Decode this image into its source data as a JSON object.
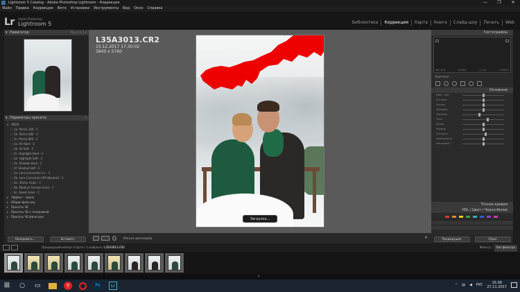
{
  "window": {
    "title": "Lightroom 5 Catalog - Adobe Photoshop Lightroom - Коррекция",
    "controls": [
      "—",
      "❐",
      "✕"
    ]
  },
  "menu": [
    "Файл",
    "Правка",
    "Коррекция",
    "Фото",
    "Установки",
    "Инструменты",
    "Вид",
    "Окно",
    "Справка"
  ],
  "identity": {
    "logo": "Lr",
    "small_caption": "Adobe Photoshop",
    "app_name": "Lightroom 5"
  },
  "modules": [
    {
      "label": "Библиотека",
      "active": false
    },
    {
      "label": "Коррекция",
      "active": true
    },
    {
      "label": "Карта",
      "active": false
    },
    {
      "label": "Книга",
      "active": false
    },
    {
      "label": "Слайд-шоу",
      "active": false
    },
    {
      "label": "Печать",
      "active": false
    },
    {
      "label": "Web",
      "active": false
    }
  ],
  "left_panel": {
    "navigator_title": "Навигатор",
    "navigator_options": "FILL  1:1  3:1",
    "presets_title": "Параметры пресета",
    "presets": [
      {
        "label": "VSCO",
        "kind": "folder open"
      },
      {
        "label": "1a. Portra 160 - C",
        "kind": "leaf"
      },
      {
        "label": "1b. Portra 400 - C",
        "kind": "leaf"
      },
      {
        "label": "1c. Portra 800 - C",
        "kind": "leaf"
      },
      {
        "label": "2a. All Hard - C",
        "kind": "leaf"
      },
      {
        "label": "2b. All Soft - C",
        "kind": "leaf"
      },
      {
        "label": "2c. Highlight Hard - C",
        "kind": "leaf"
      },
      {
        "label": "2d. Highlight Soft - C",
        "kind": "leaf"
      },
      {
        "label": "2e. Shadow Hard - C",
        "kind": "leaf"
      },
      {
        "label": "2f. Shadow Soft - C",
        "kind": "leaf"
      },
      {
        "label": "3a. Lens Correction 0+ - C",
        "kind": "leaf"
      },
      {
        "label": "3b. Lens Correction Off (Neutral) - C",
        "kind": "leaf"
      },
      {
        "label": "4a. 35mm Grain - C",
        "kind": "leaf"
      },
      {
        "label": "4b. Medium Format Grain - C",
        "kind": "leaf"
      },
      {
        "label": "4c. Reset Grain - C",
        "kind": "leaf"
      },
      {
        "label": "Эффект - зерно",
        "kind": "folder"
      },
      {
        "label": "Общие фильтры",
        "kind": "folder"
      },
      {
        "label": "Пресеты ЧБ",
        "kind": "folder"
      },
      {
        "label": "Пресеты ЧБ с тонировкой",
        "kind": "folder"
      },
      {
        "label": "Пресеты ЧБ фильтров",
        "kind": "folder"
      }
    ],
    "copy_button": "Копировать...",
    "paste_button": "Вставить"
  },
  "photo_info": {
    "filename": "L35A3013.CR2",
    "datetime": "15.12.2017 17:30:02",
    "dimensions": "3840 x 5760"
  },
  "loading_label": "Загрузка...",
  "toolbar": {
    "soft_proof_label": "Мягкая цветопроба"
  },
  "right_panel": {
    "histogram_title": "Гистограмма",
    "histogram_values": [
      "ISO 100",
      "50 мм",
      "f / 1,4",
      "1/320 с"
    ],
    "original_label": "Оригинал",
    "basic_title": "Основные",
    "sliders": [
      {
        "label": "Цвет. тем.",
        "level": 0.5
      },
      {
        "label": "Оттенок",
        "level": 0.5
      },
      {
        "label": "Экспоз.",
        "level": 0.5
      },
      {
        "label": "Контраст",
        "level": 0.5
      },
      {
        "label": "Светлые",
        "level": 0.4
      },
      {
        "label": "Тени",
        "level": 0.6
      },
      {
        "label": "Белые",
        "level": 0.5
      },
      {
        "label": "Черные",
        "level": 0.5
      },
      {
        "label": "Четкость",
        "level": 0.55
      },
      {
        "label": "Красочность",
        "level": 0.5
      },
      {
        "label": "Насыщенн.",
        "level": 0.5
      }
    ],
    "tone_curve_title": "Точная кривая",
    "hsl_title": "HSL / Цвет / Черно-белое",
    "hsl_colors": [
      "#d23a3a",
      "#e08a2a",
      "#e0d02a",
      "#3aa04a",
      "#2ab0c0",
      "#3a5ad0",
      "#9a3ad0",
      "#d03aa0"
    ],
    "prev_button": "Предыдущие",
    "reset_button": "Сброс"
  },
  "filmstrip_bar": {
    "crumb": "Предыдущий импорт",
    "count": "8 фото / 1 выбрано /",
    "file": "L35A3013.CR2",
    "filter_label": "Фильтр :",
    "filter_value": "Без фильтра"
  },
  "filmstrip": [
    {
      "selected": true,
      "tone": "cool"
    },
    {
      "selected": false,
      "tone": "warm"
    },
    {
      "selected": false,
      "tone": "warm"
    },
    {
      "selected": false,
      "tone": "cool"
    },
    {
      "selected": false,
      "tone": "cool"
    },
    {
      "selected": false,
      "tone": "warm"
    },
    {
      "selected": false,
      "tone": "dark"
    },
    {
      "selected": false,
      "tone": "dark"
    },
    {
      "selected": false,
      "tone": "cool"
    }
  ],
  "taskbar": {
    "lang": "РУС",
    "time": "15:38",
    "date": "27.11.2017",
    "icons": [
      "windows-start-icon",
      "search-icon",
      "task-view-icon",
      "file-explorer-icon",
      "yandex-browser-icon",
      "opera-icon",
      "photoshop-icon",
      "lightroom-icon"
    ]
  }
}
